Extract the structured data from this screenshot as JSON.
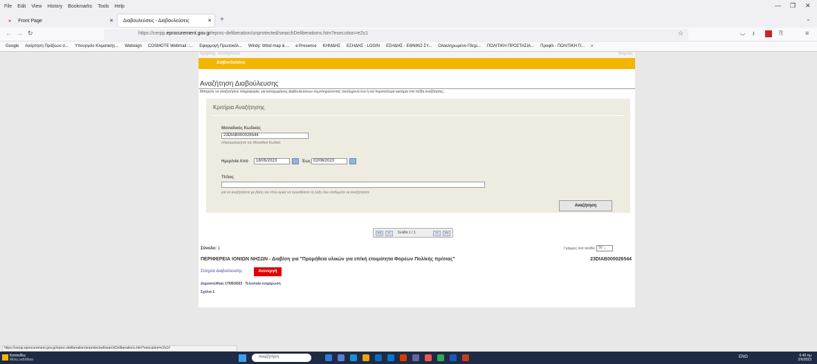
{
  "browser": {
    "menu": [
      "File",
      "Edit",
      "View",
      "History",
      "Bookmarks",
      "Tools",
      "Help"
    ],
    "tabs": [
      "Front Page",
      "Διαβουλεύσεις - Διαβουλεύσεις"
    ],
    "url_prefix": "https://cerpp.",
    "url_domain": "eprocurement.gov.gr",
    "url_suffix": "/eproc-deliberation/unprotected/searchDeliberations.htm?execution=e2s1",
    "bookmarks": [
      "Google",
      "Ανάρτηση Πράξεων σ...",
      "Υπουργείο Κλιματικής...",
      "Webisign",
      "COSMOTE Webmail ::...",
      "Εφαρμογή Πρωτοκόλ...",
      "Windy: Wind map & ...",
      "e:Presence",
      "ΚΗΜΔΗΣ",
      "ΕΣΗΔΗΣ - LOGIN",
      "ΕΣΗΔΗΣ - ΕΘΝΙΚΟ ΣΥ...",
      "Ολοκληρωμένο Πληρ...",
      "ΠΟΛΙΤΙΚΗ ΠΡΟΣΤΑΣΙΑ...",
      "Προφίλ - ΠΟΛΙΤΙΚΗ Π..."
    ],
    "status_url": "https://cerpp.eprocurement.gov.gr/eproc-deliberation/unprotected/searchDeliberations.htm?execution=e2s1#"
  },
  "page": {
    "user_line": "Χρήστης: Anonymous",
    "user_right": "Φορέας:",
    "nav_item": "Διαβουλεύσεις",
    "title": "Αναζήτηση Διαβούλευσης",
    "intro": "Μπορείτε να αναζητήσετε πληροφορίες για καταχωρήσεις Διαβουλεύσεων συμπληρώνοντας ταυτόχρονα ένα ή και περισσότερα κριτήρια στα πεδία αναζήτησης.",
    "criteria": {
      "title": "Κριτήρια Αναζήτησης",
      "code_label": "Μοναδικός Κωδικός",
      "code_value": "23DIAB000026544",
      "code_hint": "πληκτρολογήστε τον Μοναδικό Κωδικό.",
      "date_from_label": "Ημερ/νία Από",
      "date_from": "18/05/2023",
      "date_to_label": "Έως",
      "date_to": "02/06/2023",
      "title_label": "Τίτλος",
      "title_value": "",
      "title_hint": "για να αναζητήσετε με βάση τον τίτλο αρκεί να προσθέσετε τη λέξη που επιθυμείτε να αναζητήσετε",
      "search_button": "Αναζήτηση"
    },
    "pager": {
      "first": "<<",
      "prev": "<",
      "text": "Σελίδα 1 / 1",
      "next": ">",
      "last": ">>"
    },
    "total_label": "Σύνολο:",
    "total_value": "1",
    "per_page_label": "Γραμμές ανα σελίδα:",
    "per_page_value": "50",
    "result": {
      "title": "ΠΕΡΙΦΕΡΕΙΑ ΙΟΝΙΩΝ ΝΗΣΩΝ - Διαβ/ση για \"Προμήθεια υλικών για επ/κή ετοιμότητα Φορέων Πολ/κής πρ/σιας\"",
      "code": "23DIAB000026544",
      "details_link": "Στοιχεία Διαβούλευσης",
      "status_button": "Ανενεργή",
      "published_label": "Δημοσιεύθηκε",
      "published_date": "17/05/2023",
      "last_update_link": "Τελευταία ενημέρωση",
      "comments_label": "Σχόλια",
      "comments_count": "1"
    }
  },
  "taskbar": {
    "weather_title": "Καταιγίδες",
    "weather_sub": "Μόλις εκδόθηκε",
    "search_placeholder": "Αναζήτηση",
    "lang": "ENG",
    "time": "6:40 πμ",
    "date": "2/6/2023"
  }
}
